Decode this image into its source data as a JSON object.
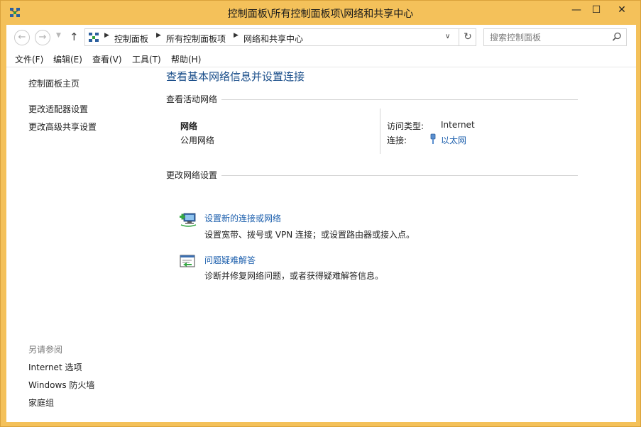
{
  "window": {
    "title": "控制面板\\所有控制面板项\\网络和共享中心",
    "minimize": "—",
    "maximize": "☐",
    "close": "✕"
  },
  "nav": {
    "back": "←",
    "forward": "→",
    "recent": "▼",
    "up": "↑",
    "breadcrumbs": [
      "控制面板",
      "所有控制面板项",
      "网络和共享中心"
    ],
    "dropdown": "∨",
    "refresh": "↻",
    "search_placeholder": "搜索控制面板"
  },
  "menu": [
    "文件(F)",
    "编辑(E)",
    "查看(V)",
    "工具(T)",
    "帮助(H)"
  ],
  "left_pane": {
    "links": [
      "控制面板主页",
      "更改适配器设置",
      "更改高级共享设置"
    ],
    "see_also_title": "另请参阅",
    "see_also": [
      "Internet 选项",
      "Windows 防火墙",
      "家庭组"
    ]
  },
  "main": {
    "title": "查看基本网络信息并设置连接",
    "active_networks_heading": "查看活动网络",
    "network": {
      "name": "网络",
      "type": "公用网络",
      "access_type_label": "访问类型:",
      "access_type_value": "Internet",
      "connection_label": "连接:",
      "connection_value": "以太网"
    },
    "change_settings_heading": "更改网络设置",
    "tasks": [
      {
        "title": "设置新的连接或网络",
        "desc": "设置宽带、拨号或 VPN 连接；或设置路由器或接入点。",
        "icon": "new-connection-icon"
      },
      {
        "title": "问题疑难解答",
        "desc": "诊断并修复网络问题，或者获得疑难解答信息。",
        "icon": "troubleshoot-icon"
      }
    ]
  },
  "colors": {
    "frame": "#f4c15a",
    "title_blue": "#1a4e8a",
    "link_blue": "#1c5fad"
  }
}
